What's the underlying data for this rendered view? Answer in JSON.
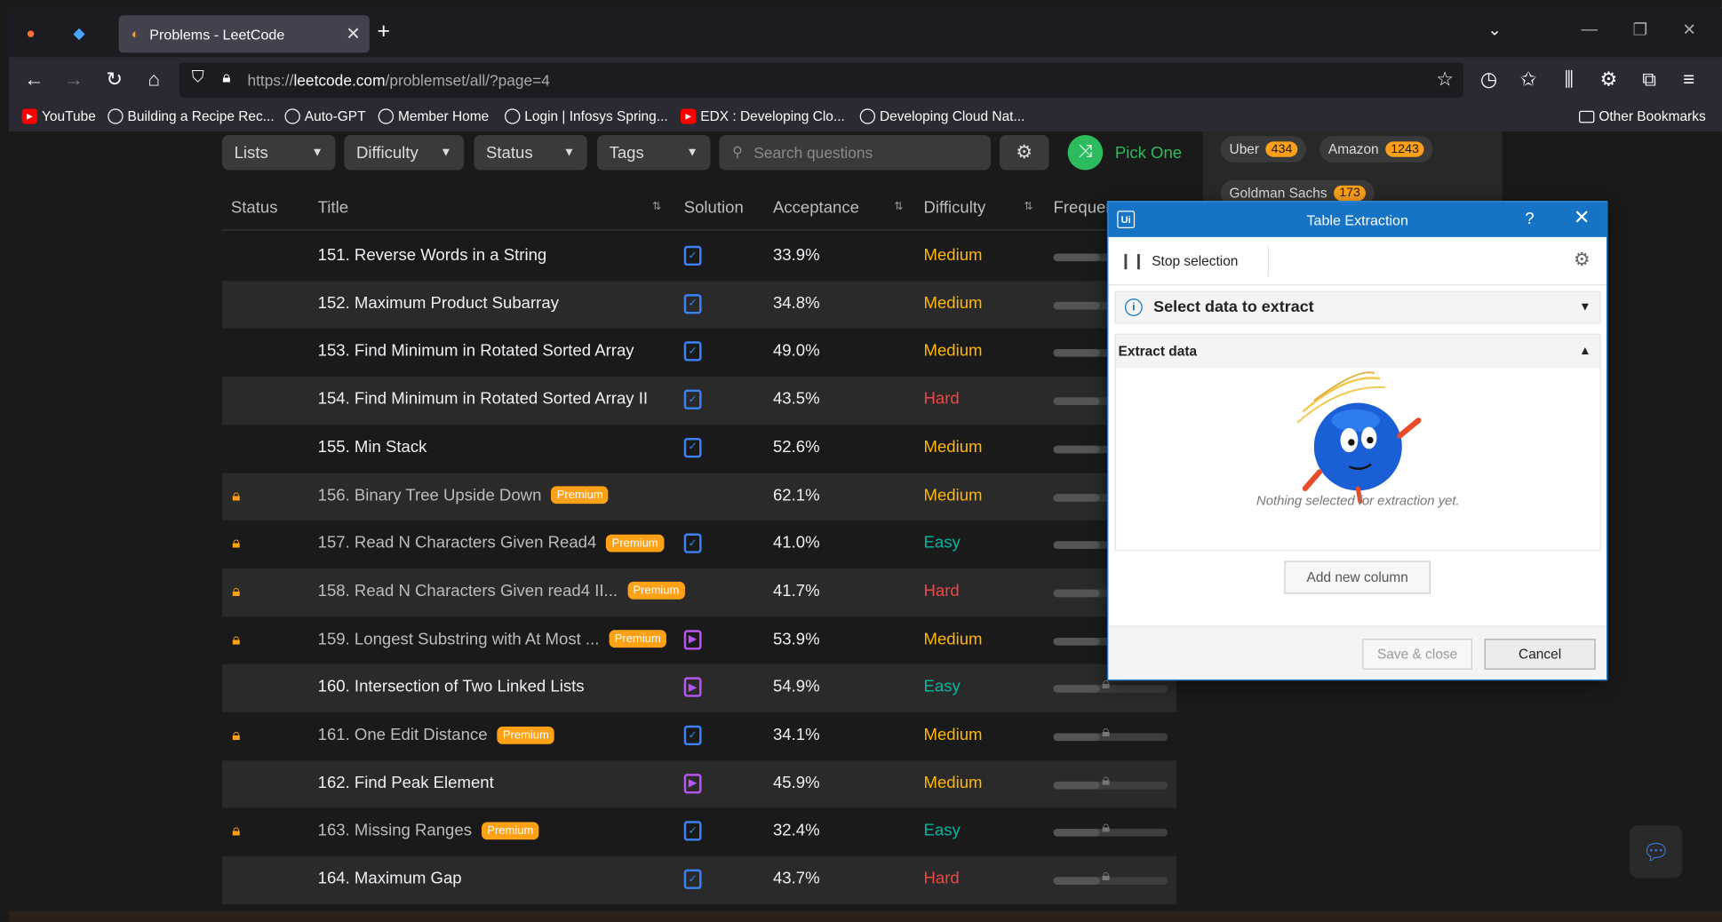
{
  "browser": {
    "tab_title": "Problems - LeetCode",
    "url_prefix": "https://",
    "url_host": "leetcode.com",
    "url_path": "/problemset/all/?page=4",
    "bookmarks": [
      {
        "label": "YouTube",
        "icon": "youtube-icon",
        "color": "#ff0000"
      },
      {
        "label": "Building a Recipe Rec...",
        "icon": "globe-icon",
        "color": "#fbfbfe"
      },
      {
        "label": "Auto-GPT",
        "icon": "github-icon",
        "color": "#fbfbfe"
      },
      {
        "label": "Member Home",
        "icon": "globe-icon",
        "color": "#fbfbfe"
      },
      {
        "label": "Login | Infosys Spring...",
        "icon": "infosys-icon",
        "color": "#fbfbfe"
      },
      {
        "label": "EDX : Developing Clo...",
        "icon": "youtube-icon",
        "color": "#ff0000"
      },
      {
        "label": "Developing Cloud Nat...",
        "icon": "globe-icon",
        "color": "#fbfbfe"
      }
    ],
    "other_bookmarks": "Other Bookmarks"
  },
  "filters": {
    "lists": "Lists",
    "difficulty": "Difficulty",
    "status": "Status",
    "tags": "Tags",
    "search_placeholder": "Search questions",
    "pick_one": "Pick One"
  },
  "companies": [
    {
      "name": "Uber",
      "count": "434"
    },
    {
      "name": "Amazon",
      "count": "1243"
    },
    {
      "name": "Goldman Sachs",
      "count": "173"
    }
  ],
  "table": {
    "headers": {
      "status": "Status",
      "title": "Title",
      "solution": "Solution",
      "acceptance": "Acceptance",
      "difficulty": "Difficulty",
      "frequency": "Frequency"
    },
    "premium_label": "Premium",
    "rows": [
      {
        "title": "151. Reverse Words in a String",
        "premium": false,
        "solution": "doc",
        "acceptance": "33.9%",
        "difficulty": "Medium"
      },
      {
        "title": "152. Maximum Product Subarray",
        "premium": false,
        "solution": "doc",
        "acceptance": "34.8%",
        "difficulty": "Medium"
      },
      {
        "title": "153. Find Minimum in Rotated Sorted Array",
        "premium": false,
        "solution": "doc",
        "acceptance": "49.0%",
        "difficulty": "Medium"
      },
      {
        "title": "154. Find Minimum in Rotated Sorted Array II",
        "premium": false,
        "solution": "doc",
        "acceptance": "43.5%",
        "difficulty": "Hard"
      },
      {
        "title": "155. Min Stack",
        "premium": false,
        "solution": "doc",
        "acceptance": "52.6%",
        "difficulty": "Medium"
      },
      {
        "title": "156. Binary Tree Upside Down",
        "premium": true,
        "solution": "none",
        "acceptance": "62.1%",
        "difficulty": "Medium"
      },
      {
        "title": "157. Read N Characters Given Read4",
        "premium": true,
        "solution": "doc",
        "acceptance": "41.0%",
        "difficulty": "Easy"
      },
      {
        "title": "158. Read N Characters Given read4 II...",
        "premium": true,
        "solution": "none",
        "acceptance": "41.7%",
        "difficulty": "Hard"
      },
      {
        "title": "159. Longest Substring with At Most ...",
        "premium": true,
        "solution": "video",
        "acceptance": "53.9%",
        "difficulty": "Medium"
      },
      {
        "title": "160. Intersection of Two Linked Lists",
        "premium": false,
        "solution": "video",
        "acceptance": "54.9%",
        "difficulty": "Easy"
      },
      {
        "title": "161. One Edit Distance",
        "premium": true,
        "solution": "doc",
        "acceptance": "34.1%",
        "difficulty": "Medium"
      },
      {
        "title": "162. Find Peak Element",
        "premium": false,
        "solution": "video",
        "acceptance": "45.9%",
        "difficulty": "Medium"
      },
      {
        "title": "163. Missing Ranges",
        "premium": true,
        "solution": "doc",
        "acceptance": "32.4%",
        "difficulty": "Easy"
      },
      {
        "title": "164. Maximum Gap",
        "premium": false,
        "solution": "doc",
        "acceptance": "43.7%",
        "difficulty": "Hard"
      }
    ]
  },
  "dialog": {
    "title": "Table Extraction",
    "stop_selection": "Stop selection",
    "select_data": "Select data to extract",
    "extract_data": "Extract data",
    "empty_message": "Nothing selected for extraction yet.",
    "add_column": "Add new column",
    "save_close": "Save & close",
    "cancel": "Cancel"
  },
  "colors": {
    "accent": "#ffa116",
    "easy": "#00b8a3",
    "medium": "#ffb800",
    "hard": "#ef4743",
    "uipath_blue": "#1673c5"
  }
}
